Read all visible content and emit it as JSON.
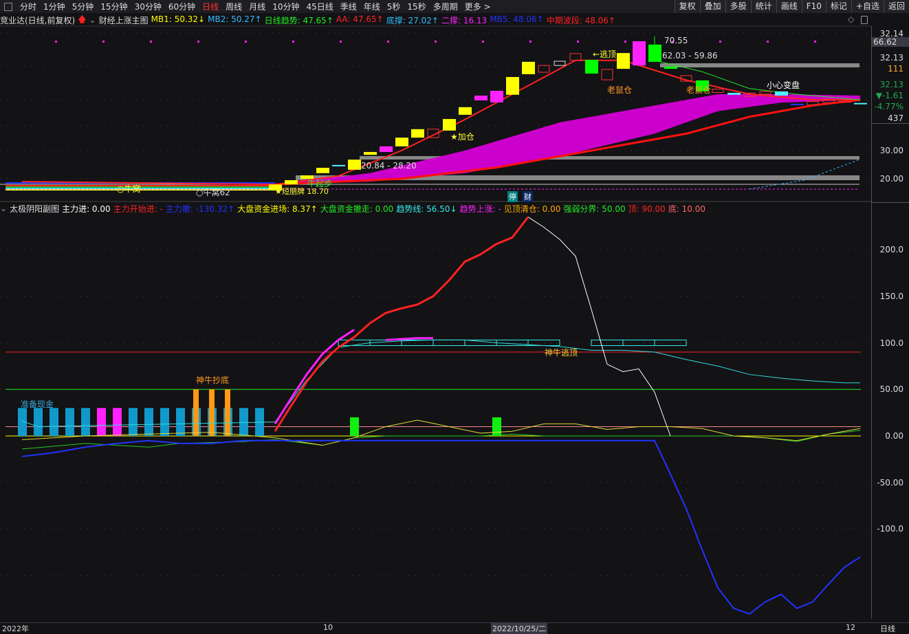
{
  "toolbar": {
    "periods": [
      "分时",
      "1分钟",
      "5分钟",
      "15分钟",
      "30分钟",
      "60分钟",
      "日线",
      "周线",
      "月线",
      "10分钟",
      "45日线",
      "季线",
      "年线",
      "5秒",
      "15秒",
      "多周期",
      "更多 >"
    ],
    "active": "日线",
    "right_buttons": [
      "复权",
      "叠加",
      "多股",
      "统计",
      "画线",
      "F10",
      "标记",
      "+自选",
      "返回"
    ]
  },
  "main_info": {
    "stock": "竞业达(日线,前复权)",
    "indicator": "财经上涨主图",
    "items": [
      {
        "label": "MB1: 50.32↓",
        "color": "#ffff00"
      },
      {
        "label": "MB2: 50.27↑",
        "color": "#33bbff"
      },
      {
        "label": "日线趋势: 47.65↑",
        "color": "#22ee22"
      },
      {
        "label": "AA: 47.65↑",
        "color": "#ff2222"
      },
      {
        "label": "底撑: 27.02↑",
        "color": "#33bbff"
      },
      {
        "label": "二撑: 16.13",
        "color": "#ff22ff"
      },
      {
        "label": "MB5: 48.06↑",
        "color": "#2233ff"
      },
      {
        "label": "中期波段: 48.06↑",
        "color": "#ff2222"
      }
    ]
  },
  "sub_info": {
    "indicator": "太极阴阳副图",
    "items": [
      {
        "label": "主力进: 0.00",
        "color": "#ffffff"
      },
      {
        "label": "主力开始进: -",
        "color": "#ff2222"
      },
      {
        "label": "主力撤: -130.32↑",
        "color": "#2233ff"
      },
      {
        "label": "大盘资金进场: 8.37↑",
        "color": "#ffff00"
      },
      {
        "label": "大盘资金撤走: 0.00",
        "color": "#22ee22"
      },
      {
        "label": "趋势线: 56.50↓",
        "color": "#33eeee"
      },
      {
        "label": "趋势上涨: -",
        "color": "#ff22ff"
      },
      {
        "label": "见顶清仓: 0.00",
        "color": "#ffaa00"
      },
      {
        "label": "强弱分界: 50.00",
        "color": "#22ee22"
      },
      {
        "label": "顶: 90.00",
        "color": "#ff2222"
      },
      {
        "label": "底: 10.00",
        "color": "#ff6666"
      }
    ]
  },
  "right_axis": {
    "top_price": "32.14",
    "crosshair_value": "66.62",
    "price": "32.13",
    "volume": "111",
    "last": "32.13",
    "change": "▼-1.61",
    "change_pct": "-4.77%",
    "count": "437",
    "ticks_main": [
      "30.00",
      "20.00"
    ],
    "ticks_sub": [
      "200.0",
      "150.0",
      "100.0",
      "50.00",
      "0.00",
      "-50.00",
      "-100.0"
    ]
  },
  "badges": [
    "停",
    "财"
  ],
  "annotations": {
    "niu_wo": "○牛窝",
    "niu_wo2": "○牛窝62",
    "duan": "★短朋牌 18.70",
    "niu_qibu": "牛起步",
    "range1": "20.84 - 28.20",
    "jiacang": "★加仓",
    "taoding": "←逃顶",
    "laoshu1": "老鼠仓",
    "laoshu2": "老鼠仓",
    "xiaoxin": "小心变盘",
    "high": "70.55",
    "range2": "62.03 - 59.86",
    "zhunbei": "准备现金",
    "chaodi": "神牛抄底",
    "taoding2": "神牛逃顶"
  },
  "bottom_axis": {
    "start": "2022年",
    "m10": "10",
    "cursor_date": "2022/10/25/二",
    "m12": "12",
    "period": "日线"
  },
  "colors": {
    "up": "#ff3333",
    "down": "#00ff00",
    "bg": "#131215"
  },
  "chart_data": [
    {
      "type": "candlestick",
      "title": "财经上涨主图",
      "price_ticks": [
        20,
        30
      ],
      "candles": [
        [
          16,
          15.9,
          18.0,
          "yellow"
        ],
        [
          17,
          18.0,
          19.5,
          "yellow"
        ],
        [
          18,
          20.0,
          21.2,
          "yellow"
        ],
        [
          19,
          22.0,
          23.9,
          "yellow"
        ],
        [
          20,
          24.8,
          24.9,
          "cyan"
        ],
        [
          21,
          23.2,
          26.8,
          "yellow"
        ],
        [
          22,
          28.5,
          29.5,
          "yellow"
        ],
        [
          23,
          29.5,
          31.5,
          "magenta"
        ],
        [
          24,
          31.5,
          34.6,
          "yellow"
        ],
        [
          25,
          34.6,
          37.6,
          "yellow"
        ],
        [
          26,
          34.6,
          37.6,
          "hollow-red"
        ],
        [
          27,
          37.1,
          41.2,
          "yellow"
        ],
        [
          28,
          42.7,
          45.4,
          "yellow"
        ],
        [
          29,
          47.8,
          49.5,
          "magenta"
        ],
        [
          30,
          47.1,
          51.2,
          "magenta"
        ],
        [
          31,
          49.8,
          56.1,
          "yellow"
        ],
        [
          32,
          57.1,
          61.5,
          "yellow"
        ],
        [
          33,
          57.8,
          60.2,
          "hollow-red"
        ],
        [
          34,
          60.2,
          61.7,
          "hollow-white"
        ],
        [
          35,
          62.0,
          64.4,
          "hollow-red"
        ],
        [
          36,
          62.2,
          57.3,
          "green"
        ],
        [
          37,
          55.1,
          58.8,
          "hollow-red"
        ],
        [
          38,
          59.0,
          64.6,
          "yellow"
        ],
        [
          39,
          60.2,
          68.8,
          "magenta"
        ],
        [
          40,
          67.6,
          61.5,
          "green"
        ],
        [
          41,
          59.8,
          59.0,
          "green"
        ],
        [
          42,
          54.6,
          56.6,
          "hollow-red"
        ],
        [
          43,
          54.9,
          51.0,
          "green"
        ],
        [
          44,
          50.6,
          51.8,
          "hollow-red"
        ],
        [
          45,
          49.8,
          50.5,
          "cyan"
        ],
        [
          46,
          49.2,
          50.4,
          "hollow-red"
        ],
        [
          47,
          50.0,
          51.0,
          "hollow-red"
        ],
        [
          48,
          49.5,
          51.0,
          "cyan"
        ],
        [
          49,
          46.4,
          46.6,
          "blue"
        ],
        [
          50,
          46.2,
          47.4,
          "hollow-red"
        ],
        [
          51,
          47.0,
          48.2,
          "hollow-red"
        ],
        [
          52,
          47.0,
          47.6,
          "red"
        ],
        [
          53,
          46.8,
          46.9,
          "cyan"
        ]
      ],
      "ma_red": [
        [
          0,
          19
        ],
        [
          16,
          18
        ],
        [
          20,
          21
        ],
        [
          24,
          30
        ],
        [
          28,
          41
        ],
        [
          32,
          53
        ],
        [
          35,
          62
        ],
        [
          38,
          62
        ],
        [
          42,
          55
        ],
        [
          46,
          50
        ],
        [
          50,
          48
        ],
        [
          53,
          48
        ]
      ],
      "ma_red_lower": [
        [
          16,
          18
        ],
        [
          24,
          20
        ],
        [
          30,
          24
        ],
        [
          36,
          30
        ],
        [
          42,
          36
        ],
        [
          46,
          42
        ],
        [
          50,
          46
        ],
        [
          53,
          48
        ]
      ],
      "band_top": [
        [
          16,
          18
        ],
        [
          22,
          22
        ],
        [
          28,
          30
        ],
        [
          34,
          40
        ],
        [
          40,
          46
        ],
        [
          44,
          50
        ],
        [
          48,
          50
        ],
        [
          53,
          49.5
        ]
      ],
      "band_bottom": [
        [
          16,
          18
        ],
        [
          22,
          19
        ],
        [
          28,
          22
        ],
        [
          34,
          28
        ],
        [
          40,
          36
        ],
        [
          44,
          44
        ],
        [
          48,
          47
        ],
        [
          53,
          48
        ]
      ],
      "green_line": [
        [
          40,
          62
        ],
        [
          43,
          58
        ],
        [
          46,
          52
        ],
        [
          49,
          50
        ],
        [
          53,
          48
        ]
      ]
    },
    {
      "type": "line",
      "title": "太极阴阳副图",
      "ylim": [
        -190,
        240
      ],
      "hlines": {
        "top": 90,
        "strong": 50,
        "bottom": 10,
        "zero": 0
      },
      "main_in": [
        [
          16,
          5
        ],
        [
          17,
          32
        ],
        [
          18,
          58
        ],
        [
          19,
          80
        ],
        [
          20,
          95
        ],
        [
          21,
          106
        ],
        [
          22,
          121
        ],
        [
          23,
          132
        ],
        [
          24,
          137
        ],
        [
          25,
          141
        ],
        [
          26,
          150
        ],
        [
          27,
          167
        ],
        [
          28,
          187
        ],
        [
          29,
          195
        ],
        [
          30,
          206
        ],
        [
          31,
          213
        ],
        [
          32,
          235
        ]
      ],
      "top_out": [
        [
          32,
          235
        ],
        [
          33,
          224
        ],
        [
          34,
          211
        ],
        [
          35,
          193
        ],
        [
          36,
          136
        ],
        [
          37,
          77
        ],
        [
          38,
          69
        ],
        [
          39,
          72
        ],
        [
          40,
          47
        ],
        [
          41,
          0
        ]
      ],
      "main_out": [
        [
          0,
          -22
        ],
        [
          2,
          -18
        ],
        [
          4,
          -12
        ],
        [
          6,
          -8
        ],
        [
          8,
          -5
        ],
        [
          10,
          -8
        ],
        [
          12,
          -8
        ],
        [
          14,
          -5
        ],
        [
          16,
          -5
        ],
        [
          40,
          -5
        ],
        [
          41,
          -41
        ],
        [
          42,
          -78
        ],
        [
          43,
          -122
        ],
        [
          44,
          -163
        ],
        [
          45,
          -185
        ],
        [
          46,
          -191
        ],
        [
          47,
          -178
        ],
        [
          48,
          -170
        ],
        [
          49,
          -185
        ],
        [
          50,
          -178
        ],
        [
          51,
          -159
        ],
        [
          52,
          -141
        ],
        [
          53,
          -130
        ]
      ],
      "trend": [
        [
          0,
          16
        ],
        [
          1,
          10
        ],
        [
          16,
          15
        ],
        [
          18,
          60
        ],
        [
          20,
          95
        ],
        [
          22,
          100
        ],
        [
          24,
          102
        ],
        [
          26,
          103
        ],
        [
          28,
          103
        ],
        [
          30,
          100
        ],
        [
          32,
          98
        ],
        [
          34,
          96
        ],
        [
          36,
          92
        ],
        [
          38,
          92
        ],
        [
          40,
          90
        ],
        [
          42,
          82
        ],
        [
          44,
          75
        ],
        [
          46,
          66
        ],
        [
          48,
          62
        ],
        [
          50,
          59
        ],
        [
          52,
          57
        ],
        [
          53,
          57
        ]
      ],
      "dapan_in": [
        [
          0,
          -4
        ],
        [
          4,
          0
        ],
        [
          8,
          2
        ],
        [
          12,
          4
        ],
        [
          16,
          -2
        ],
        [
          19,
          -10
        ],
        [
          21,
          -2
        ],
        [
          23,
          10
        ],
        [
          25,
          17
        ],
        [
          27,
          10
        ],
        [
          29,
          3
        ],
        [
          31,
          5
        ],
        [
          33,
          13
        ],
        [
          35,
          13
        ],
        [
          37,
          7
        ],
        [
          39,
          10
        ],
        [
          41,
          10
        ],
        [
          43,
          8
        ],
        [
          45,
          0
        ],
        [
          47,
          -2
        ],
        [
          49,
          -5
        ],
        [
          51,
          2
        ],
        [
          53,
          8
        ]
      ],
      "dapan_out": [
        [
          0,
          -14
        ],
        [
          4,
          -8
        ],
        [
          8,
          -12
        ],
        [
          10,
          -8
        ],
        [
          14,
          -6
        ],
        [
          16,
          -4
        ],
        [
          19,
          -10
        ],
        [
          21,
          -2
        ],
        [
          23,
          0
        ],
        [
          29,
          0
        ],
        [
          31,
          2
        ],
        [
          33,
          0
        ],
        [
          45,
          0
        ],
        [
          47,
          -2
        ],
        [
          49,
          -6
        ],
        [
          51,
          2
        ],
        [
          53,
          6
        ]
      ],
      "cash_bars": [
        0,
        1,
        2,
        3,
        4,
        5,
        6,
        7,
        8,
        9,
        10,
        11,
        12,
        13,
        14,
        15
      ],
      "cash_value": 30,
      "magenta_bars": [
        5,
        6
      ],
      "orange_bars": [
        11,
        12,
        13
      ],
      "orange_value": 50,
      "green_bars": [
        21,
        30
      ],
      "green_value": 20,
      "top_boxes": [
        [
          20,
          29
        ],
        [
          30,
          34
        ],
        [
          36,
          41
        ]
      ]
    }
  ]
}
